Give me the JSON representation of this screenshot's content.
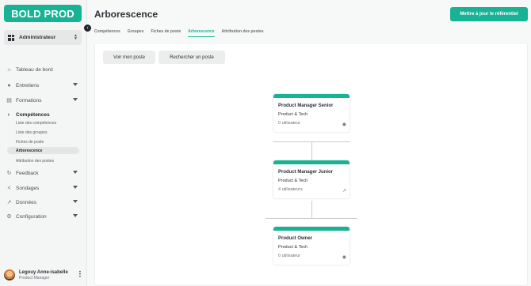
{
  "app": {
    "logo_text": "BOLD PROD",
    "brand_color": "#18b394",
    "collapse_icon": "‹"
  },
  "sidebar": {
    "role": "Administrateur",
    "items": [
      {
        "label": "Tableau de bord",
        "icon": "home-icon",
        "glyph": "⌂"
      },
      {
        "label": "Entretiens",
        "icon": "chat-icon",
        "glyph": "●"
      },
      {
        "label": "Formations",
        "icon": "training-icon",
        "glyph": "▤"
      },
      {
        "label": "Compétences",
        "icon": "skills-icon",
        "glyph": "◐"
      },
      {
        "label": "Feedback",
        "icon": "refresh-icon",
        "glyph": "↻"
      },
      {
        "label": "Sondages",
        "icon": "share-icon",
        "glyph": "<"
      },
      {
        "label": "Données",
        "icon": "trend-icon",
        "glyph": "↗"
      },
      {
        "label": "Configuration",
        "icon": "gear-icon",
        "glyph": "⚙"
      }
    ],
    "sub_items": [
      "Liste des compétences",
      "Liste des groupes",
      "Fiches de poste",
      "Arborescence",
      "Attribution des postes"
    ]
  },
  "user": {
    "name": "Legouy Anne-isabelle",
    "role": "Product Manager"
  },
  "header": {
    "title": "Arborescence",
    "action_label": "Mettre à jour le référentiel"
  },
  "tabs": [
    "Compétences",
    "Groupes",
    "Fiches de poste",
    "Arborescence",
    "Attribution des postes"
  ],
  "toolbar": {
    "view_label": "Voir mon poste",
    "search_label": "Rechercher un poste"
  },
  "tree": [
    {
      "title": "Product Manager Senior",
      "dept": "Product & Tech",
      "users": "0 utilisateur",
      "icon": "eye-icon",
      "glyph": "◉"
    },
    {
      "title": "Product Manager Junior",
      "dept": "Product & Tech",
      "users": "4 utilisateurs",
      "icon": "external-link-icon",
      "glyph": "↗"
    },
    {
      "title": "Product Owner",
      "dept": "Product & Tech",
      "users": "0 utilisateur",
      "icon": "eye-icon",
      "glyph": "◉"
    }
  ]
}
